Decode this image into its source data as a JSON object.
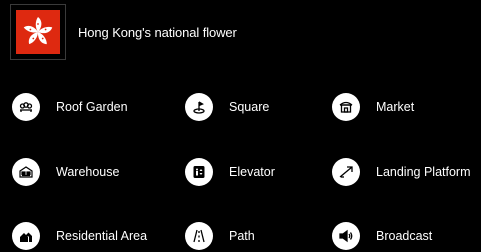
{
  "header": {
    "title": "Hong Kong's national flower",
    "flag_color": "#de2910"
  },
  "items": [
    {
      "label": "Roof Garden",
      "icon": "roof-garden-icon"
    },
    {
      "label": "Square",
      "icon": "square-icon"
    },
    {
      "label": "Market",
      "icon": "market-icon"
    },
    {
      "label": "Warehouse",
      "icon": "warehouse-icon"
    },
    {
      "label": "Elevator",
      "icon": "elevator-icon"
    },
    {
      "label": "Landing Platform",
      "icon": "landing-platform-icon"
    },
    {
      "label": "Residential Area",
      "icon": "residential-area-icon"
    },
    {
      "label": "Path",
      "icon": "path-icon"
    },
    {
      "label": "Broadcast",
      "icon": "broadcast-icon"
    }
  ]
}
